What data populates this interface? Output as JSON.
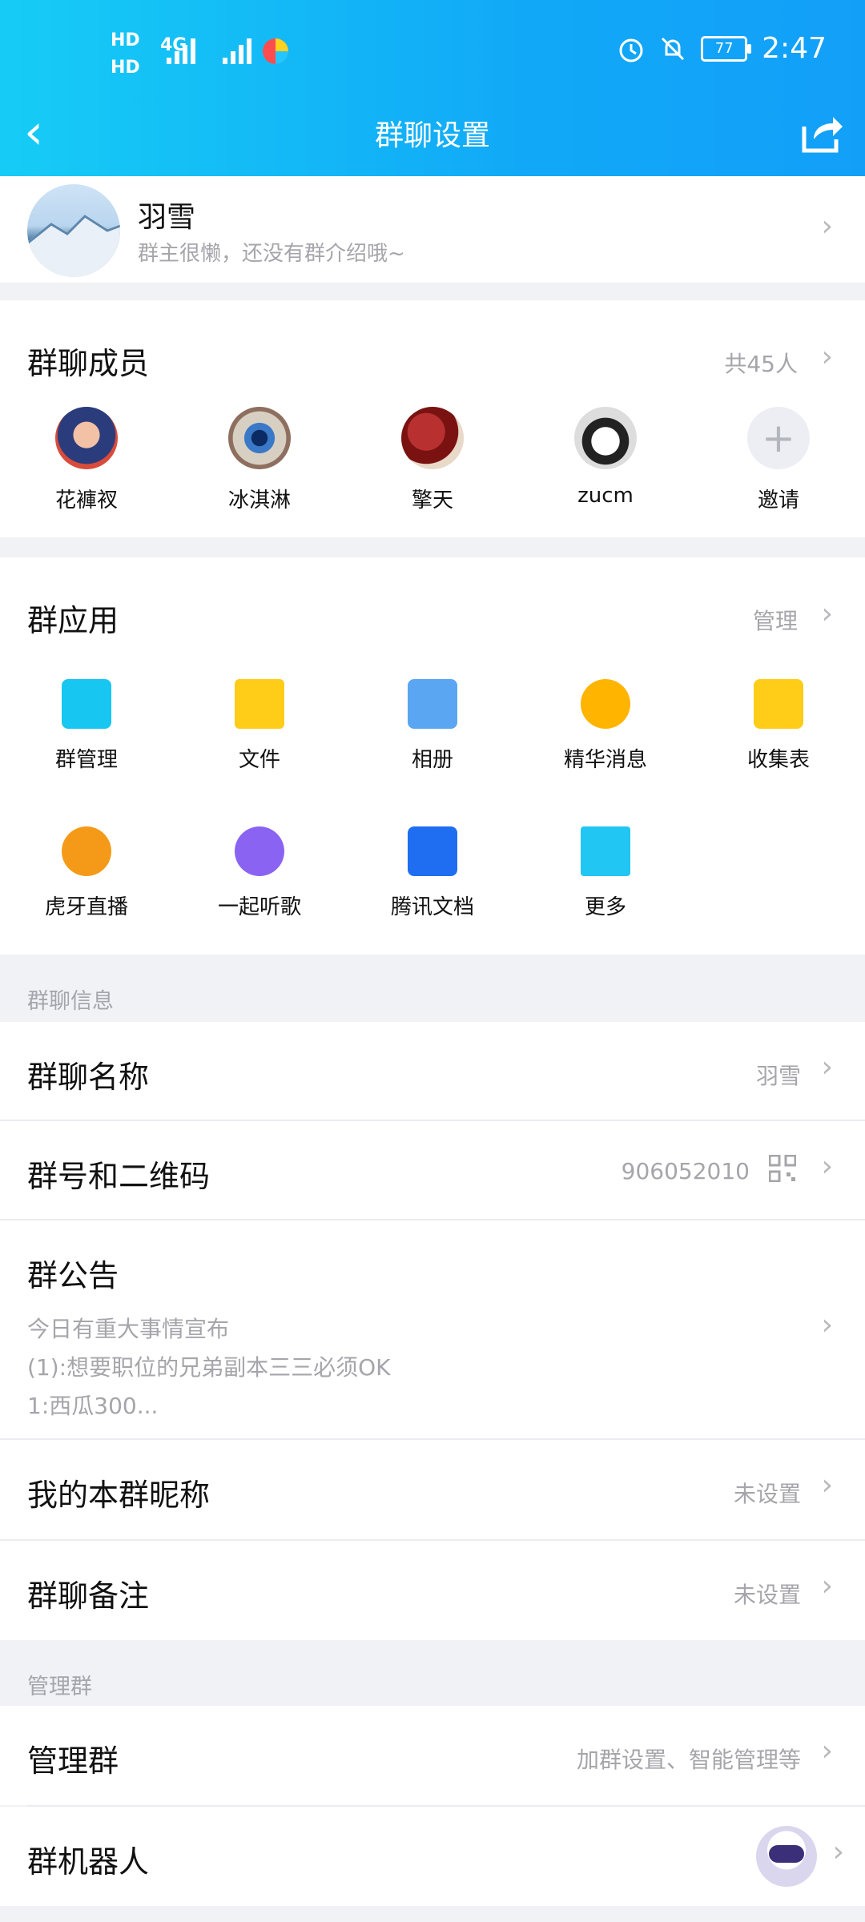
{
  "status": {
    "time": "2:47",
    "battery": "77",
    "hd1": "HD",
    "hd2": "HD",
    "net": "4G"
  },
  "nav": {
    "title": "群聊设置"
  },
  "group": {
    "name": "羽雪",
    "intro": "群主很懒，还没有群介绍哦~"
  },
  "members": {
    "title": "群聊成员",
    "count": "共45人",
    "list": [
      {
        "name": "花褲衩"
      },
      {
        "name": "冰淇淋"
      },
      {
        "name": "擎天"
      },
      {
        "name": "zucm"
      },
      {
        "name": "邀请"
      }
    ]
  },
  "apps": {
    "title": "群应用",
    "manage": "管理",
    "items": [
      {
        "label": "群管理",
        "icon": "group-manage-icon",
        "color": "#18c6f2"
      },
      {
        "label": "文件",
        "icon": "folder-icon",
        "color": "#ffcc18"
      },
      {
        "label": "相册",
        "icon": "album-icon",
        "color": "#5aa6f2"
      },
      {
        "label": "精华消息",
        "icon": "essence-icon",
        "color": "#ffb400"
      },
      {
        "label": "收集表",
        "icon": "form-icon",
        "color": "#ffcc18"
      },
      {
        "label": "虎牙直播",
        "icon": "huya-icon",
        "color": "#f59a18"
      },
      {
        "label": "一起听歌",
        "icon": "music-icon",
        "color": "#8a63f2"
      },
      {
        "label": "腾讯文档",
        "icon": "tencent-docs-icon",
        "color": "#1f6ef2"
      },
      {
        "label": "更多",
        "icon": "more-icon",
        "color": "#22c6f2"
      }
    ]
  },
  "info": {
    "section": "群聊信息",
    "name_label": "群聊名称",
    "name_value": "羽雪",
    "id_label": "群号和二维码",
    "id_value": "906052010",
    "notice_label": "群公告",
    "notice_lines": [
      "今日有重大事情宣布",
      "(1):想要职位的兄弟副本三三必须OK",
      "1:西瓜300..."
    ],
    "nick_label": "我的本群昵称",
    "nick_value": "未设置",
    "remark_label": "群聊备注",
    "remark_value": "未设置"
  },
  "manage": {
    "section": "管理群",
    "manage_label": "管理群",
    "manage_value": "加群设置、智能管理等",
    "robot_label": "群机器人"
  }
}
